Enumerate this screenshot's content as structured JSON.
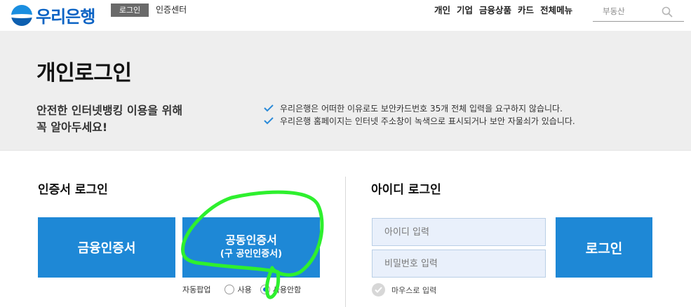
{
  "header": {
    "logo_text": "우리은행",
    "login_tab": "로그인",
    "cert_center": "인증센터",
    "gnb": [
      "개인",
      "기업",
      "금융상품",
      "카드",
      "전체메뉴"
    ],
    "search_placeholder": "부동산"
  },
  "hero": {
    "title": "개인로그인",
    "subtitle_line1": "안전한 인터넷뱅킹 이용을 위해",
    "subtitle_line2": "꼭 알아두세요!",
    "notices": [
      "우리은행은 어떠한 이유로도 보안카드번호 35개 전체 입력을 요구하지 않습니다.",
      "우리은행 홈페이지는 인터넷 주소창이 녹색으로 표시되거나 보안 자물쇠가 있습니다."
    ]
  },
  "cert_login": {
    "title": "인증서 로그인",
    "financial_cert_label": "금융인증서",
    "joint_cert_label": "공동인증서",
    "joint_cert_sub": "(구 공인인증서)",
    "auto_popup_label": "자동팝업",
    "radio_use": "사용",
    "radio_no_use": "사용안함",
    "selected": "사용안함"
  },
  "id_login": {
    "title": "아이디 로그인",
    "id_placeholder": "아이디 입력",
    "pw_placeholder": "비밀번호 입력",
    "login_button": "로그인",
    "mouse_input": "마우스로 입력"
  },
  "colors": {
    "brand_blue": "#1e88d6",
    "logo_blue": "#0b63c4",
    "annotation_green": "#2ef02e"
  }
}
